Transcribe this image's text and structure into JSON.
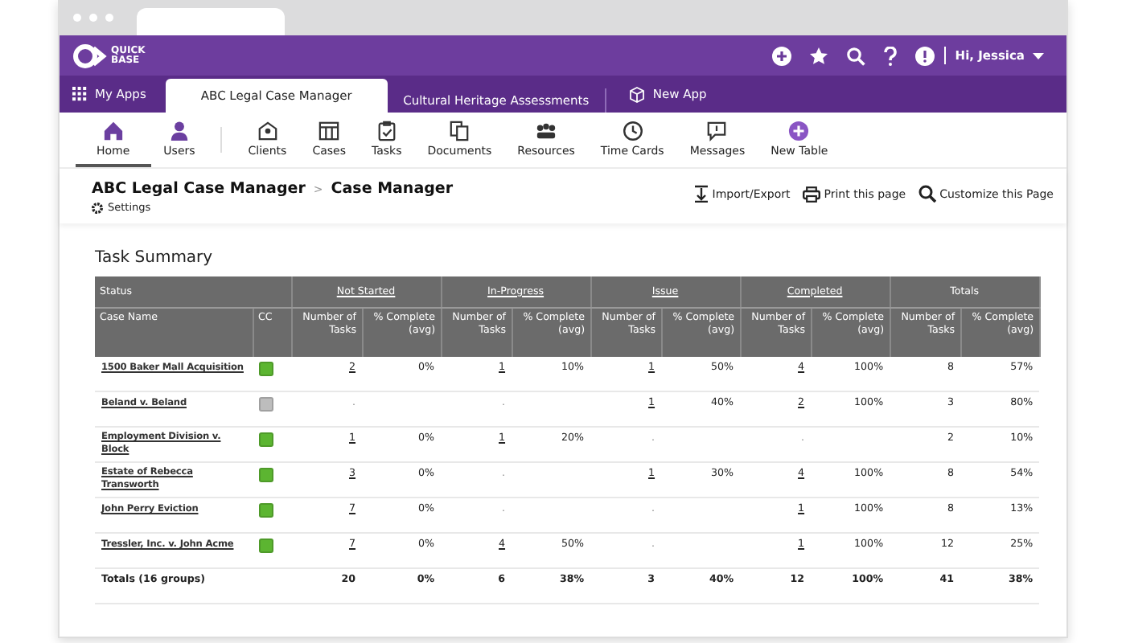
{
  "brand": {
    "line1": "QUICK",
    "line2": "BASE"
  },
  "user_menu": {
    "label": "Hi, Jessica"
  },
  "app_tabs": [
    {
      "label": "My Apps",
      "selected": false
    },
    {
      "label": "ABC Legal Case Manager",
      "selected": true
    },
    {
      "label": "Cultural Heritage Assessments",
      "selected": false
    },
    {
      "label": "New App",
      "selected": false
    }
  ],
  "nav": [
    {
      "label": "Home",
      "selected": true
    },
    {
      "label": "Users",
      "selected": false
    },
    {
      "label": "Clients",
      "selected": false
    },
    {
      "label": "Cases",
      "selected": false
    },
    {
      "label": "Tasks",
      "selected": false
    },
    {
      "label": "Documents",
      "selected": false
    },
    {
      "label": "Resources",
      "selected": false
    },
    {
      "label": "Time Cards",
      "selected": false
    },
    {
      "label": "Messages",
      "selected": false
    },
    {
      "label": "New Table",
      "selected": false
    }
  ],
  "breadcrumb": {
    "app": "ABC Legal Case Manager",
    "separator": ">",
    "page": "Case Manager",
    "settings": "Settings"
  },
  "actions": [
    "Import/Export",
    "Print this page",
    "Customize this Page"
  ],
  "report": {
    "title": "Task Summary",
    "status_label": "Status",
    "case_label": "Case Name",
    "cc_label": "CC",
    "groups": [
      {
        "label": "Not Started",
        "linked": true,
        "count_label": "Number of Tasks",
        "pct_label": "% Complete (avg)"
      },
      {
        "label": "In-Progress",
        "linked": true,
        "count_label": "Number of Tasks",
        "pct_label": "% Complete (avg)"
      },
      {
        "label": "Issue",
        "linked": true,
        "count_label": "Number of Tasks",
        "pct_label": "% Complete (avg)"
      },
      {
        "label": "Completed",
        "linked": true,
        "count_label": "Number of Tasks",
        "pct_label": "% Complete (avg)"
      },
      {
        "label": "Totals",
        "linked": false,
        "count_label": "Number of Tasks",
        "pct_label": "% Complete (avg)"
      }
    ],
    "rows": [
      {
        "kind": "case",
        "name": "1500 Baker Mall Acquisition",
        "color": "#5cb531",
        "cells": [
          [
            "2",
            "0%"
          ],
          [
            "1",
            "10%"
          ],
          [
            "1",
            "50%"
          ],
          [
            "4",
            "100%"
          ],
          [
            "8",
            "57%"
          ]
        ]
      },
      {
        "kind": "case",
        "name": "Beland v. Beland",
        "color": "#bdbdbd",
        "cells": [
          [
            "."
          ],
          [
            "."
          ],
          [
            "1",
            "40%"
          ],
          [
            "2",
            "100%"
          ],
          [
            "3",
            "80%"
          ]
        ]
      },
      {
        "kind": "case",
        "name": "Employment Division v. Block",
        "color": "#5cb531",
        "cells": [
          [
            "1",
            "0%"
          ],
          [
            "1",
            "20%"
          ],
          [
            "."
          ],
          [
            "."
          ],
          [
            "2",
            "10%"
          ]
        ]
      },
      {
        "kind": "case",
        "name": "Estate of Rebecca Transworth",
        "color": "#5cb531",
        "cells": [
          [
            "3",
            "0%"
          ],
          [
            "."
          ],
          [
            "1",
            "30%"
          ],
          [
            "4",
            "100%"
          ],
          [
            "8",
            "54%"
          ]
        ]
      },
      {
        "kind": "case",
        "name": "John Perry Eviction",
        "color": "#5cb531",
        "cells": [
          [
            "7",
            "0%"
          ],
          [
            "."
          ],
          [
            "."
          ],
          [
            "1",
            "100%"
          ],
          [
            "8",
            "13%"
          ]
        ]
      },
      {
        "kind": "case",
        "name": "Tressler, Inc. v. John Acme",
        "color": "#5cb531",
        "cells": [
          [
            "7",
            "0%"
          ],
          [
            "4",
            "50%"
          ],
          [
            "."
          ],
          [
            "1",
            "100%"
          ],
          [
            "12",
            "25%"
          ]
        ]
      },
      {
        "kind": "total",
        "name": "Totals (16 groups)",
        "cells": [
          [
            "20",
            "0%"
          ],
          [
            "6",
            "38%"
          ],
          [
            "3",
            "40%"
          ],
          [
            "12",
            "100%"
          ],
          [
            "41",
            "38%"
          ]
        ]
      }
    ]
  }
}
